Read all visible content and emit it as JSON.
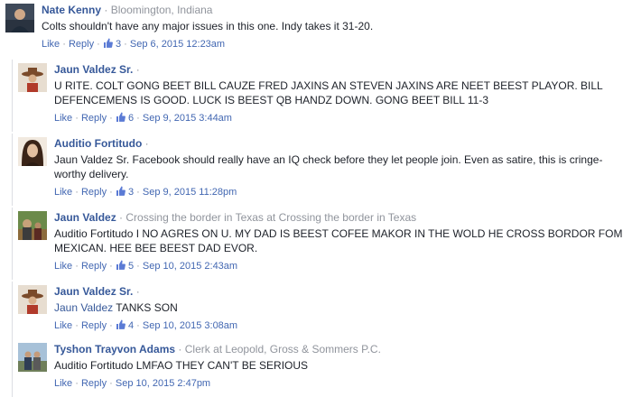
{
  "separator": "·",
  "like_label": "Like",
  "reply_label": "Reply",
  "colors": {
    "name": "#365899",
    "link": "#4267b2",
    "meta": "#90949c",
    "text": "#1d2129"
  },
  "comments": [
    {
      "author": "Nate Kenny",
      "meta": "Bloomington, Indiana",
      "tag": "",
      "text": "Colts shouldn't have any major issues in this one. Indy takes it 31-20.",
      "likes": "3",
      "date": "Sep 6, 2015 12:23am"
    },
    {
      "author": "Jaun Valdez Sr.",
      "meta": "",
      "tag": "",
      "text": "U RITE. COLT GONG BEET BILL CAUZE FRED JAXINS AN STEVEN JAXINS ARE NEET BEEST PLAYOR. BILL DEFENCEMENS IS GOOD. LUCK IS BEEST QB HANDZ DOWN. GONG BEET BILL 11-3",
      "likes": "6",
      "date": "Sep 9, 2015 3:44am"
    },
    {
      "author": "Auditio Fortitudo",
      "meta": "",
      "tag": "",
      "text": "Jaun Valdez Sr. Facebook should really have an IQ check before they let people join. Even as satire, this is cringe-worthy delivery.",
      "likes": "3",
      "date": "Sep 9, 2015 11:28pm"
    },
    {
      "author": "Jaun Valdez",
      "meta": "Crossing the border in Texas at Crossing the border in Texas",
      "tag": "",
      "text": "Auditio Fortitudo I NO AGRES ON U. MY DAD IS BEEST COFEE MAKOR IN THE WOLD HE CROSS BORDOR FOM MEXICAN. HEE BEE BEEST DAD EVOR.",
      "likes": "5",
      "date": "Sep 10, 2015 2:43am"
    },
    {
      "author": "Jaun Valdez Sr.",
      "meta": "",
      "tag": "Jaun Valdez",
      "text": "TANKS SON",
      "likes": "4",
      "date": "Sep 10, 2015 3:08am"
    },
    {
      "author": "Tyshon Trayvon Adams",
      "meta": "Clerk at Leopold, Gross & Sommers P.C.",
      "tag": "",
      "text": "Auditio Fortitudo LMFAO THEY CAN'T BE SERIOUS",
      "likes": "",
      "date": "Sep 10, 2015 2:47pm"
    }
  ]
}
